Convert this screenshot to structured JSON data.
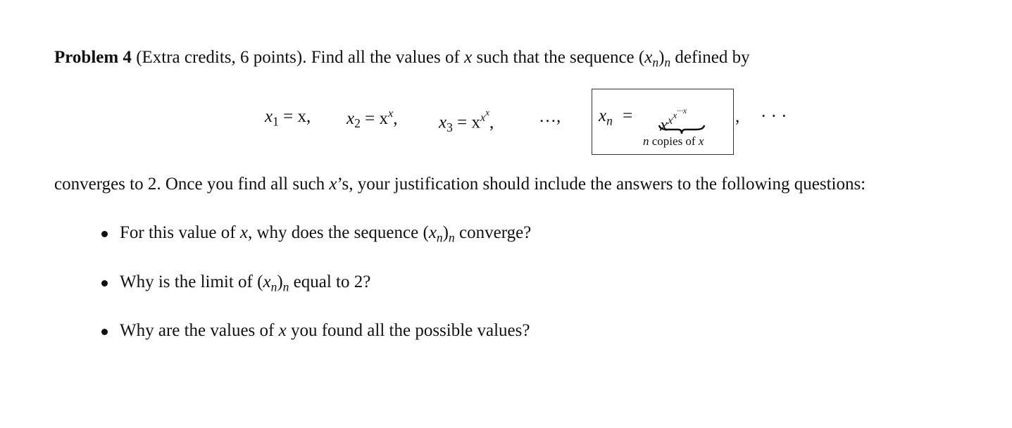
{
  "problem": {
    "heading": "Problem 4",
    "credit": "(Extra credits, 6 points).",
    "intro_a": "Find all the values of",
    "var_x": "x",
    "intro_b": "such that the sequence",
    "seq_open": "(x",
    "sub_n": "n",
    "seq_close": ")",
    "intro_c": "defined by"
  },
  "equation": {
    "t1": "x",
    "t1_sub": "1",
    "t1_rhs": " = x,",
    "t2": "x",
    "t2_sub": "2",
    "t2_rhs": " = x",
    "t2_sup": "x",
    "t2_comma": ",",
    "t3": "x",
    "t3_sub": "3",
    "t3_rhs": " = x",
    "t3_sup": "x",
    "t3_supsup": "x",
    "t3_comma": ",",
    "ellipsis1": "…,",
    "boxed_lhs": "x",
    "boxed_sub": "n",
    "boxed_eq": "=",
    "tower_base": "x",
    "tower_sup1": "x",
    "tower_sup2": "x",
    "tower_dots": "···x",
    "brace_label_n": "n",
    "brace_label": " copies of ",
    "brace_label_x": "x",
    "comma_after_box": ",",
    "ellipsis2": "· · ·"
  },
  "body": {
    "line2": "converges to 2. Once you find all such ",
    "line2_x": "x",
    "line2_rest": "’s, your justification should include the answers to the following questions:"
  },
  "questions": [
    {
      "pre": "For this value of ",
      "x": "x",
      "mid": ", why does the sequence (",
      "seq": "x",
      "sub": "n",
      "post": ")",
      "sub2": "n",
      "end": " converge?"
    },
    {
      "pre": "Why is the limit of (",
      "seq": "x",
      "sub": "n",
      "post": ")",
      "sub2": "n",
      "end": " equal to 2?"
    },
    {
      "pre": "Why are the values of ",
      "x": "x",
      "end": " you found all the possible values?"
    }
  ]
}
